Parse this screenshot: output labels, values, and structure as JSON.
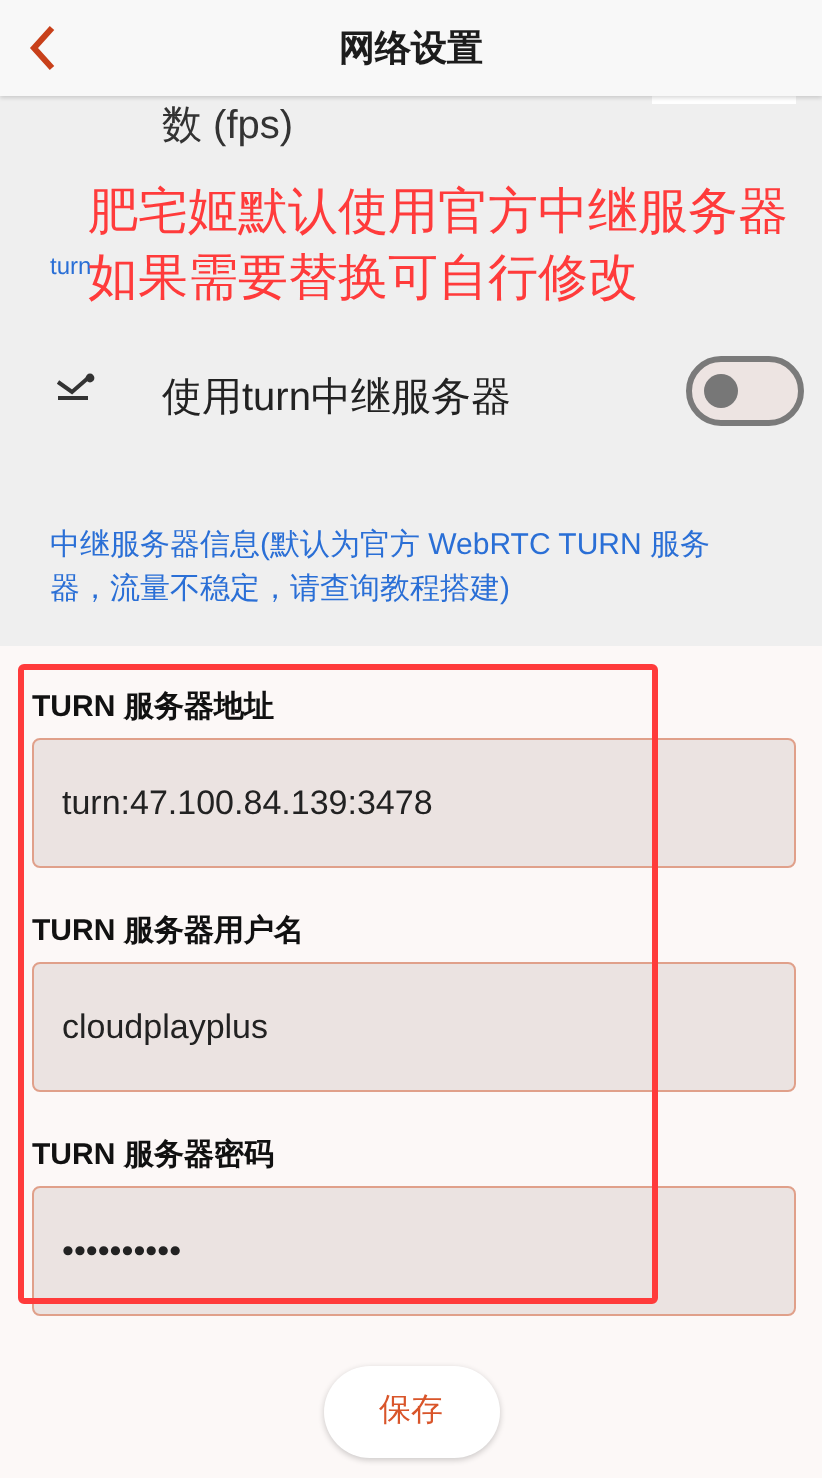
{
  "header": {
    "title": "网络设置"
  },
  "partial_row": {
    "label": "数 (fps)"
  },
  "section_label": "turn",
  "annotation": [
    "肥宅姬默认使用官方中继服务器",
    "如果需要替换可自行修改"
  ],
  "turn_toggle": {
    "label": "使用turn中继服务器",
    "on": false
  },
  "info": "中继服务器信息(默认为官方 WebRTC TURN 服务器，流量不稳定，请查询教程搭建)",
  "fields": [
    {
      "label": "TURN 服务器地址",
      "value": "turn:47.100.84.139:3478"
    },
    {
      "label": "TURN 服务器用户名",
      "value": "cloudplayplus"
    },
    {
      "label": "TURN 服务器密码",
      "value": "••••••••••"
    }
  ],
  "save_button": "保存"
}
